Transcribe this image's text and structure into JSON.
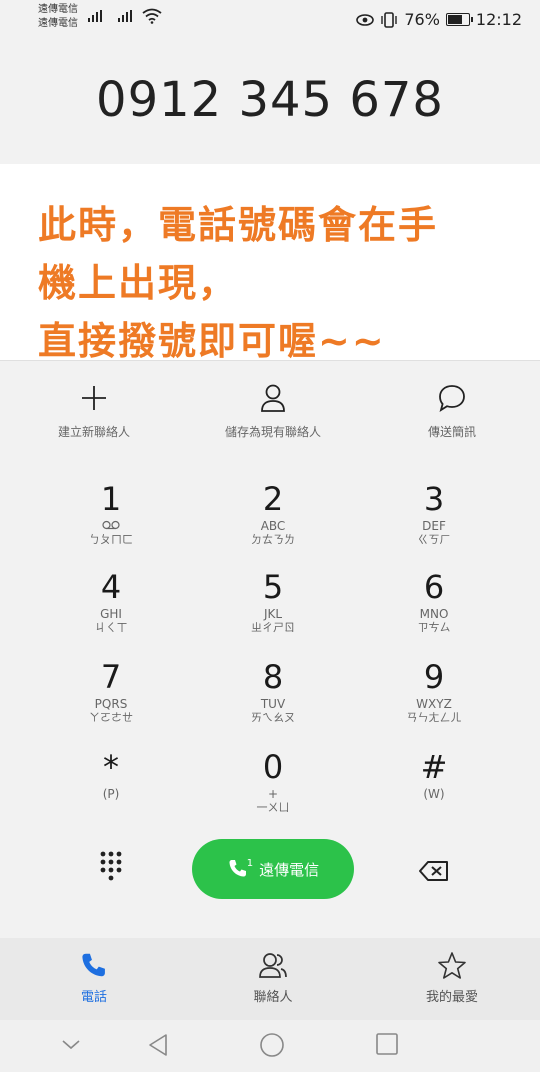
{
  "status": {
    "carrier1": "遠傳電信",
    "carrier2": "遠傳電信",
    "battery": "76%",
    "time": "12:12"
  },
  "dial_number": "0912 345 678",
  "note_lines": [
    "此時，電話號碼會在手",
    "機上出現，",
    "直接撥號即可喔~~"
  ],
  "actions": [
    {
      "label": "建立新聯絡人",
      "icon": "plus-icon"
    },
    {
      "label": "儲存為現有聯絡人",
      "icon": "person-icon"
    },
    {
      "label": "傳送簡訊",
      "icon": "chat-bubble-icon"
    }
  ],
  "keys": [
    {
      "digit": "1",
      "letters": "",
      "zhuyin": "ㄅㄆㄇㄈ",
      "sub_icon": "voicemail-icon"
    },
    {
      "digit": "2",
      "letters": "ABC",
      "zhuyin": "ㄉㄊㄋㄌ"
    },
    {
      "digit": "3",
      "letters": "DEF",
      "zhuyin": "ㄍㄎㄏ"
    },
    {
      "digit": "4",
      "letters": "GHI",
      "zhuyin": "ㄐㄑㄒ"
    },
    {
      "digit": "5",
      "letters": "JKL",
      "zhuyin": "ㄓㄔㄕㄖ"
    },
    {
      "digit": "6",
      "letters": "MNO",
      "zhuyin": "ㄗㄘㄙ"
    },
    {
      "digit": "7",
      "letters": "PQRS",
      "zhuyin": "ㄚㄛㄜㄝ"
    },
    {
      "digit": "8",
      "letters": "TUV",
      "zhuyin": "ㄞㄟㄠㄡ"
    },
    {
      "digit": "9",
      "letters": "WXYZ",
      "zhuyin": "ㄢㄣㄤㄥㄦ"
    },
    {
      "digit": "*",
      "letters": "(P)",
      "zhuyin": ""
    },
    {
      "digit": "0",
      "letters": "+",
      "zhuyin": "一ㄨㄩ"
    },
    {
      "digit": "#",
      "letters": "(W)",
      "zhuyin": ""
    }
  ],
  "call_button": {
    "sim": "1",
    "label": "遠傳電信"
  },
  "tabs": [
    {
      "label": "電話",
      "icon": "phone-icon",
      "active": true
    },
    {
      "label": "聯絡人",
      "icon": "contacts-icon",
      "active": false
    },
    {
      "label": "我的最愛",
      "icon": "star-icon",
      "active": false
    }
  ],
  "colors": {
    "accent": "#1e6fe0",
    "call_green": "#2cc24a",
    "note_orange": "#ee7a25"
  }
}
